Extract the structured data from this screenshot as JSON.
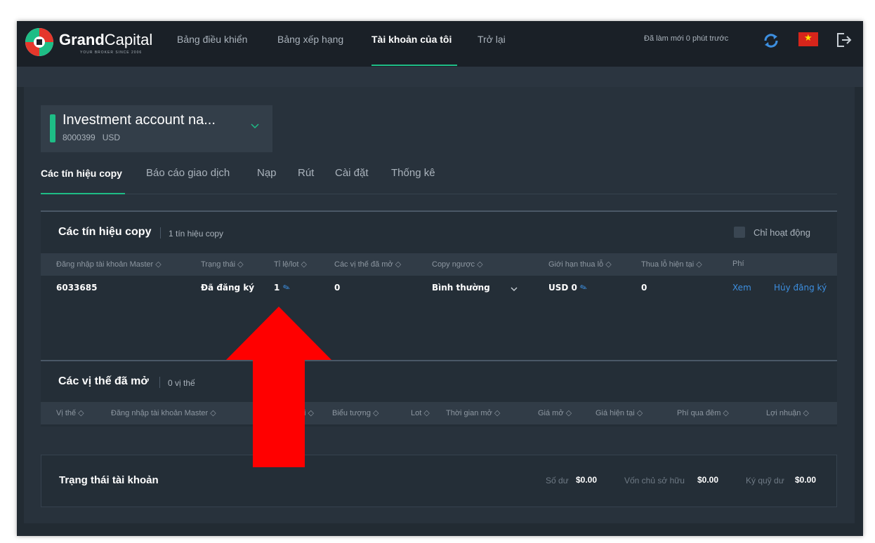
{
  "brand": {
    "name_bold": "Grand",
    "name_light": "Capital",
    "tagline": "YOUR BROKER   SINCE 2006"
  },
  "nav": {
    "items": [
      {
        "label": "Bảng điều khiển"
      },
      {
        "label": "Bảng xếp hạng"
      },
      {
        "label": "Tài khoản của tôi"
      },
      {
        "label": "Trở lại"
      }
    ],
    "active_index": 2,
    "refreshed": "Đã làm mới 0 phút trước",
    "language_flag": "vn-flag-icon"
  },
  "account": {
    "name": "Investment account na...",
    "number": "8000399",
    "currency": "USD"
  },
  "tabs": [
    {
      "label": "Các tín hiệu copy"
    },
    {
      "label": "Báo cáo giao dịch"
    },
    {
      "label": "Nạp"
    },
    {
      "label": "Rút"
    },
    {
      "label": "Cài đặt"
    },
    {
      "label": "Thống kê"
    }
  ],
  "signals": {
    "title": "Các tín hiệu copy",
    "count": "1 tín hiệu copy",
    "active_only_label": "Chỉ hoạt động",
    "active_only_checked": false,
    "columns": [
      "Đăng nhập tài khoản Master ◇",
      "Trạng thái ◇",
      "Tỉ lệ/lot ◇",
      "Các vị thế đã mở ◇",
      "Copy ngược ◇",
      "Giới hạn thua lỗ ◇",
      "Thua lỗ hiện tại ◇",
      "Phí"
    ],
    "row": {
      "master": "6033685",
      "status": "Đã đăng ký",
      "ratio": "1",
      "open_positions": "0",
      "copy_reverse": "Bình thường",
      "loss_limit": "USD 0",
      "current_loss": "0",
      "fee_link": "Xem",
      "unsubscribe": "Hủy đăng ký"
    }
  },
  "positions": {
    "title": "Các vị thế đã mở",
    "count": "0 vị thế",
    "columns": [
      "Vị thế ◇",
      "Đăng nhập tài khoản Master ◇",
      "i ◇",
      "Biểu tượng ◇",
      "Lot ◇",
      "Thời gian mở ◇",
      "Giá mở ◇",
      "Giá hiện tại ◇",
      "Phí qua đêm ◇",
      "Lợi nhuận ◇"
    ]
  },
  "account_status": {
    "title": "Trạng thái tài khoản",
    "balance_label": "Số dư",
    "balance": "$0.00",
    "equity_label": "Vốn chủ sở hữu",
    "equity": "$0.00",
    "margin_label": "Ký quỹ dư",
    "margin": "$0.00"
  },
  "annotation": {
    "color": "#ff0000"
  }
}
